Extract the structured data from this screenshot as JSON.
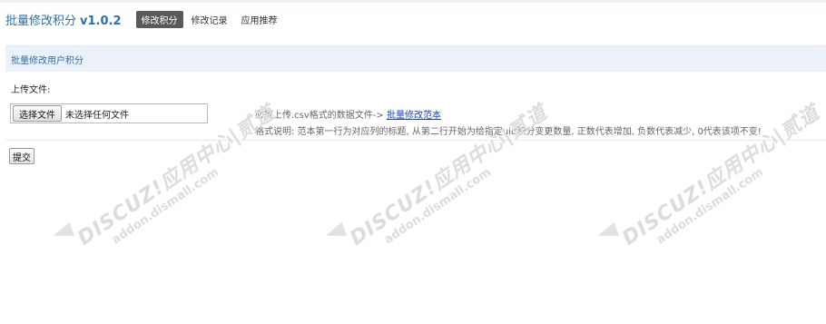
{
  "header": {
    "title": "批量修改积分",
    "version": "v1.0.2",
    "tabs": [
      {
        "label": "修改积分",
        "active": true
      },
      {
        "label": "修改记录",
        "active": false
      },
      {
        "label": "应用推荐",
        "active": false
      }
    ]
  },
  "section": {
    "title": "批量修改用户积分"
  },
  "upload": {
    "label": "上传文件:",
    "choose_button": "选择文件",
    "status": "未选择任何文件"
  },
  "hints": {
    "line1_prefix": "必须上传.csv格式的数据文件->",
    "line1_link": "批量修改范本",
    "line2": "格式说明: 范本第一行为对应列的标题, 从第二行开始为给指定uid积分变更数量, 正数代表增加, 负数代表减少, 0代表该项不变!"
  },
  "form": {
    "submit_label": "提交"
  },
  "watermark": {
    "main": "DISCUZ!应用中心|贰道",
    "sub": "addon.dismall.com"
  },
  "colors": {
    "title": "#2f6ea6",
    "section_bg": "#eaf1fb",
    "active_tab_bg": "#595959",
    "link": "#1f3fbf"
  }
}
